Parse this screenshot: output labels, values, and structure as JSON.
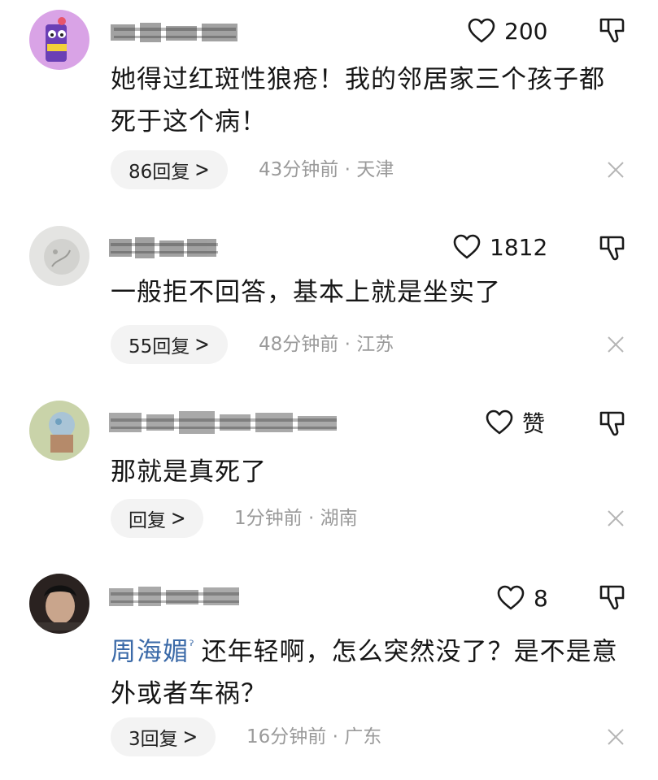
{
  "comments": [
    {
      "like_count": "200",
      "text": "她得过红斑性狼疮！我的邻居家三个孩子都死于这个病！",
      "replies_label": "86回复",
      "time": "43分钟前",
      "location": "天津"
    },
    {
      "like_count": "1812",
      "text": "一般拒不回答，基本上就是坐实了",
      "replies_label": "55回复",
      "time": "48分钟前",
      "location": "江苏"
    },
    {
      "like_count": "赞",
      "text": "那就是真死了",
      "replies_label": "回复",
      "time": "1分钟前",
      "location": "湖南"
    },
    {
      "like_count": "8",
      "mention": "周海媚",
      "text": "还年轻啊，怎么突然没了？是不是意外或者车祸？",
      "replies_label": "3回复",
      "time": "16分钟前",
      "location": "广东"
    }
  ],
  "meta_separator": "·",
  "colors": {
    "text": "#161616",
    "meta": "#9a9a9a",
    "mention": "#3b6aa8",
    "pill_bg": "#f3f3f3"
  },
  "icons": {
    "like": "heart-outline-icon",
    "dislike": "thumbs-down-outline-icon",
    "close": "close-icon",
    "chevron": "chevron-right-icon",
    "mention": "location-pin-icon"
  }
}
